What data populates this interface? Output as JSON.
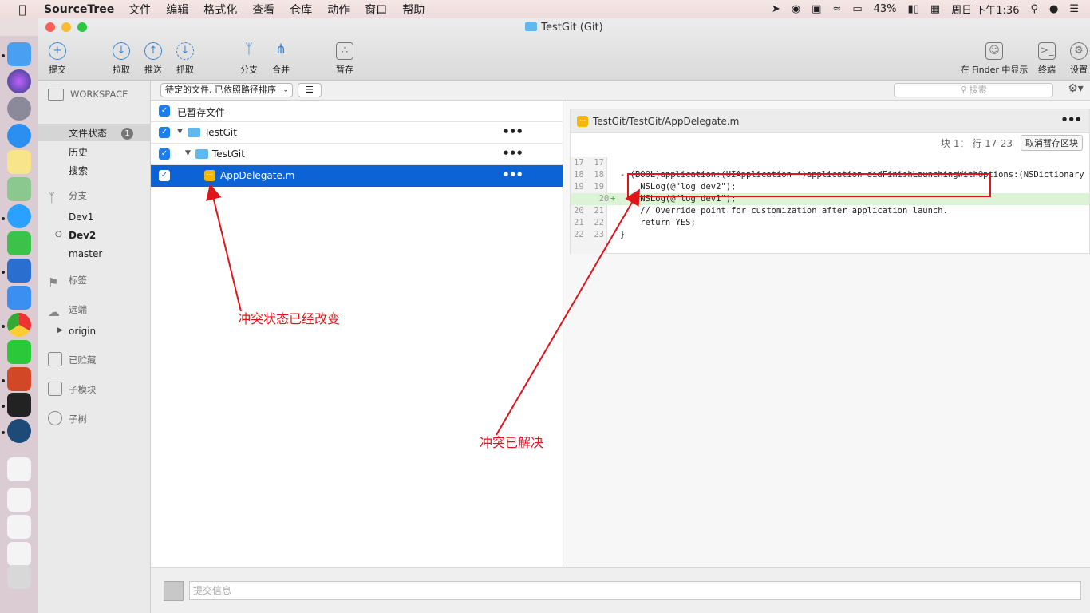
{
  "menubar": {
    "app_name": "SourceTree",
    "items": [
      "文件",
      "编辑",
      "格式化",
      "查看",
      "仓库",
      "动作",
      "窗口",
      "帮助"
    ],
    "battery": "43%",
    "clock": "周日 下午1:36"
  },
  "window": {
    "title": "TestGit (Git)"
  },
  "toolbar": {
    "commit": "提交",
    "pull": "拉取",
    "push": "推送",
    "fetch": "抓取",
    "branch": "分支",
    "merge": "合并",
    "stash": "暂存",
    "show_in_finder": "在 Finder 中显示",
    "terminal": "终端",
    "settings": "设置"
  },
  "sidebar": {
    "workspace_header": "WORKSPACE",
    "file_status": "文件状态",
    "file_status_badge": "1",
    "history": "历史",
    "search": "搜索",
    "branches_header": "分支",
    "branches": [
      "Dev1",
      "Dev2",
      "master"
    ],
    "tags_header": "标签",
    "remotes_header": "远端",
    "remote_origin": "origin",
    "stashes_header": "已贮藏",
    "submodules_header": "子模块",
    "subtrees_header": "子树"
  },
  "filter": {
    "dropdown_label": "待定的文件, 已依照路径排序",
    "search_placeholder": "搜索"
  },
  "files": {
    "staged_header": "已暂存文件",
    "rows": [
      {
        "name": "TestGit"
      },
      {
        "name": "TestGit"
      },
      {
        "name": "AppDelegate.m"
      }
    ]
  },
  "diff": {
    "file_path": "TestGit/TestGit/AppDelegate.m",
    "hunk_label": "块 1： 行 17-23",
    "unstage_button": "取消暂存区块",
    "lines": [
      {
        "old": "17",
        "new": "17",
        "marker": "",
        "text": ""
      },
      {
        "old": "18",
        "new": "18",
        "marker": "",
        "text": "- (BOOL)application:(UIApplication *)application didFinishLaunchingWithOptions:(NSDictionary *)launchOptions {"
      },
      {
        "old": "19",
        "new": "19",
        "marker": "",
        "text": "    NSLog(@\"log dev2\");"
      },
      {
        "old": "",
        "new": "20",
        "marker": "+",
        "text": "    NSLog(@\"log dev1\");"
      },
      {
        "old": "20",
        "new": "21",
        "marker": "",
        "text": "    // Override point for customization after application launch."
      },
      {
        "old": "21",
        "new": "22",
        "marker": "",
        "text": "    return YES;"
      },
      {
        "old": "22",
        "new": "23",
        "marker": "",
        "text": "}"
      }
    ]
  },
  "commit": {
    "placeholder": "提交信息"
  },
  "annotations": {
    "status_changed": "冲突状态已经改变",
    "resolved": "冲突已解决",
    "color": "#e1141b"
  }
}
